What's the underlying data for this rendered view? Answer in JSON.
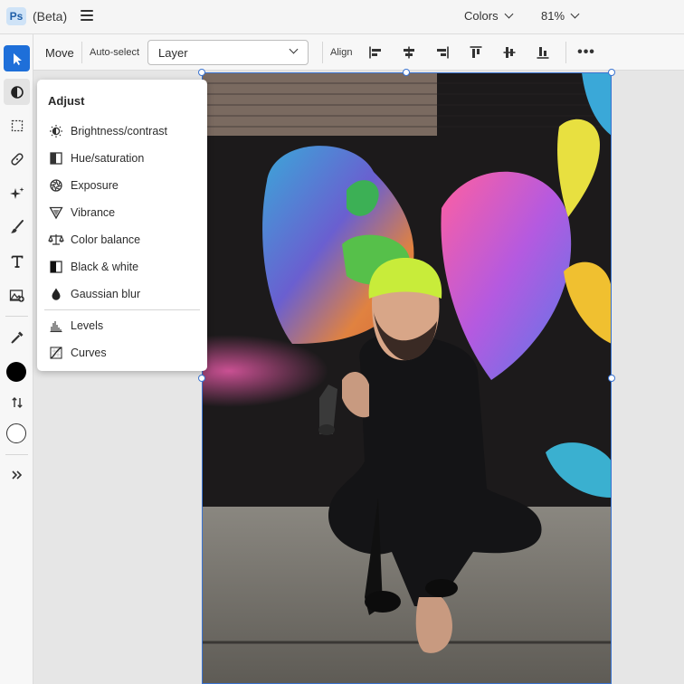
{
  "app": {
    "logo_text": "Ps",
    "beta_label": "(Beta)",
    "colors_menu": "Colors",
    "zoom_level": "81%"
  },
  "toolbar": {
    "tools": [
      {
        "name": "move-tool",
        "icon": "arrow-pointer-icon",
        "active": true
      },
      {
        "name": "adjust-tool",
        "icon": "adjust-contrast-icon",
        "active": false
      },
      {
        "name": "marquee-tool",
        "icon": "marquee-selection-icon",
        "active": false
      },
      {
        "name": "healing-tool",
        "icon": "bandage-icon",
        "active": false
      },
      {
        "name": "generative-fill-tool",
        "icon": "sparkle-icon",
        "active": false
      },
      {
        "name": "brush-tool",
        "icon": "brush-icon",
        "active": false
      },
      {
        "name": "type-tool",
        "icon": "type-icon",
        "active": false
      },
      {
        "name": "add-image-tool",
        "icon": "image-add-icon",
        "active": false
      },
      {
        "name": "eyedropper-tool",
        "icon": "eyedropper-icon",
        "active": false
      }
    ],
    "foreground_color": "#000000",
    "background_color": "#ffffff"
  },
  "options": {
    "tool_label": "Move",
    "auto_select_label": "Auto-select",
    "auto_select_value": "Layer",
    "align_label": "Align",
    "more_label": "•••"
  },
  "adjust": {
    "title": "Adjust",
    "items": [
      {
        "label": "Brightness/contrast",
        "icon": "brightness-icon"
      },
      {
        "label": "Hue/saturation",
        "icon": "hue-saturation-icon"
      },
      {
        "label": "Exposure",
        "icon": "exposure-icon"
      },
      {
        "label": "Vibrance",
        "icon": "vibrance-icon"
      },
      {
        "label": "Color balance",
        "icon": "color-balance-icon"
      },
      {
        "label": "Black & white",
        "icon": "black-white-icon"
      },
      {
        "label": "Gaussian blur",
        "icon": "drop-icon"
      },
      {
        "label": "Levels",
        "icon": "levels-icon"
      },
      {
        "label": "Curves",
        "icon": "curves-icon"
      }
    ]
  },
  "colors": {
    "accent": "#1e6fd9",
    "selection": "#3b74d1",
    "canvas_bg": "#e6e6e6"
  }
}
